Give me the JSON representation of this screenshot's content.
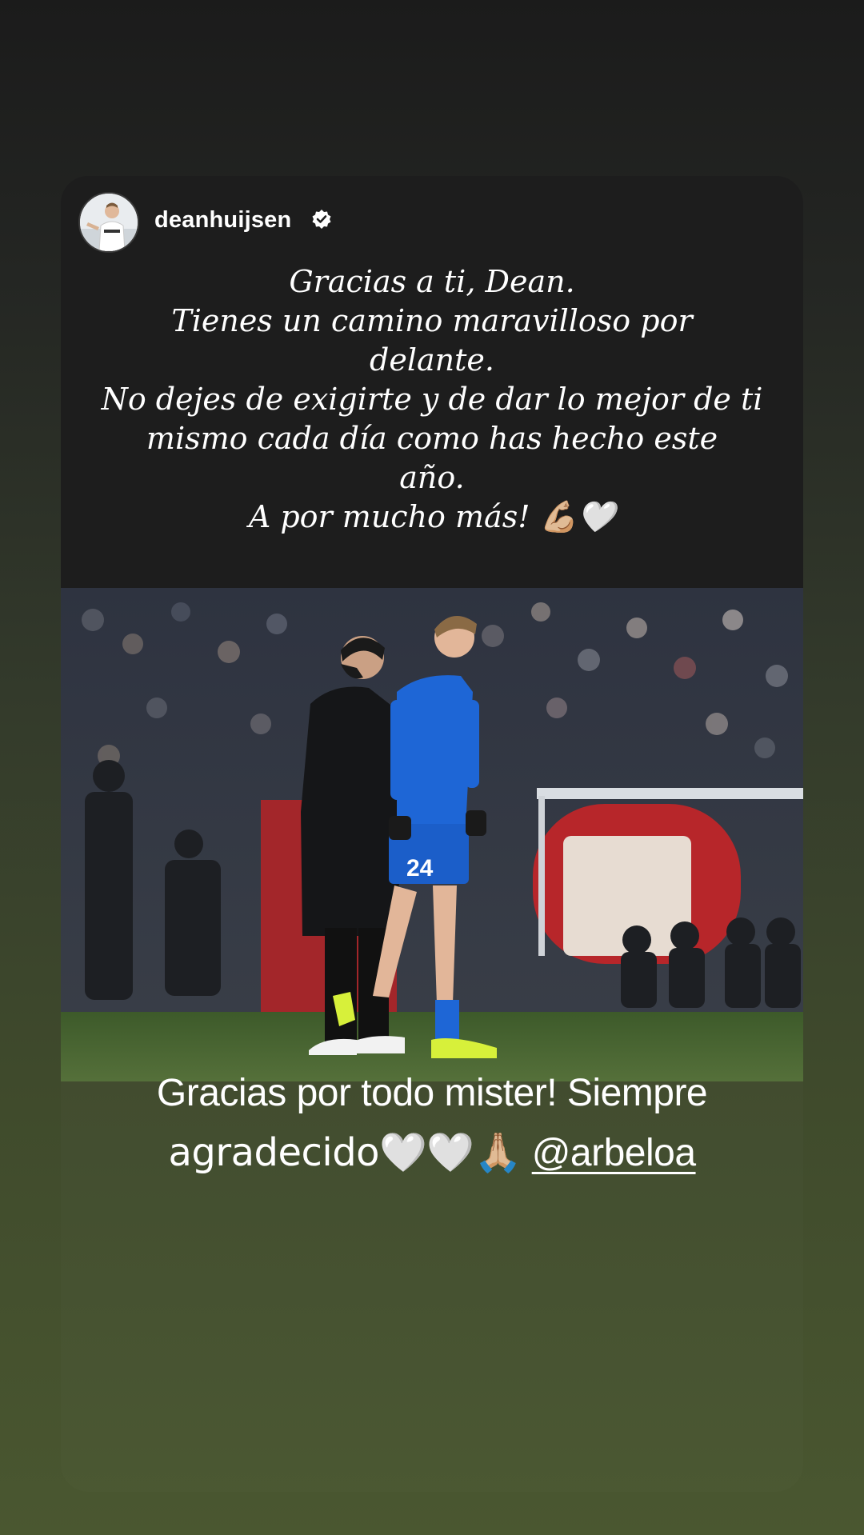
{
  "post": {
    "username": "deanhuijsen",
    "verified": true,
    "avatar_icon": "profile-photo",
    "caption_lines": [
      "Gracias a ti, Dean.",
      "Tienes un camino maravilloso por",
      "delante.",
      "No dejes de exigirte y de dar lo mejor de ti",
      "mismo cada día como has hecho este",
      "año.",
      "A por mucho más! 💪🏼🤍"
    ],
    "photo_description_icon": "football-photo",
    "jersey_number": "24"
  },
  "story": {
    "text_line1": "Gracias por todo mister! Siempre",
    "text_line2": "agradecido🤍🤍🙏🏼",
    "mention": "@arbeloa"
  },
  "colors": {
    "background_top": "#1b1b1b",
    "background_bottom": "#4a5730",
    "card_top": "#1d1d1d",
    "jersey_blue": "#1e66d6"
  }
}
